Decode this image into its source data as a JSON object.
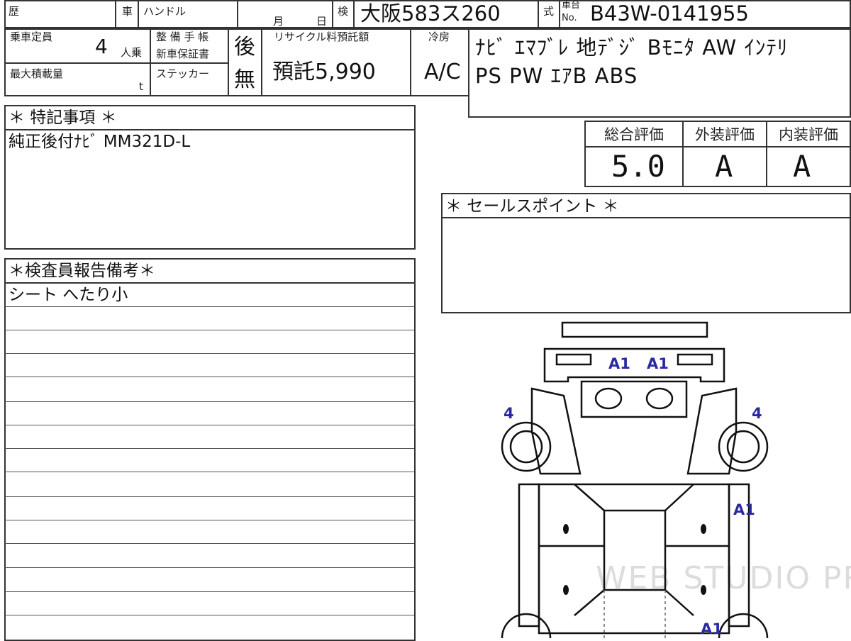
{
  "header": {
    "history_label": "歴",
    "car_label": "車",
    "handle_label": "ハンドル",
    "month_label": "月",
    "day_label": "日",
    "inspection_label": "検",
    "plate": "大阪583ス260",
    "type_label": "式",
    "chassis_label_top": "車台",
    "chassis_label_bottom": "No.",
    "chassis_no": "B43W-0141955"
  },
  "specs": {
    "capacity_label": "乗車定員",
    "capacity_value": "4",
    "capacity_unit": "人乗",
    "maintenance_label_1": "整 備 手 帳",
    "maintenance_label_2": "新車保証書",
    "maintenance_value": "後",
    "max_load_label": "最大積載量",
    "max_load_unit": "t",
    "sticker_label": "ステッカー",
    "sticker_value": "無",
    "recycle_label": "リサイクル料預託額",
    "recycle_value": "預託5,990",
    "cooler_label": "冷房",
    "cooler_value": "A/C"
  },
  "equipment": {
    "line1": "ﾅﾋﾞ ｴﾏﾌﾞﾚ 地ﾃﾞｼﾞ Bﾓﾆﾀ AW ｲﾝﾃﾘ",
    "line2": "PS PW ｴｱB ABS"
  },
  "special_notes": {
    "title": "＊ 特記事項 ＊",
    "text": "純正後付ﾅﾋﾞ MM321D-L"
  },
  "ratings": {
    "overall_label": "総合評価",
    "overall_value": "5.0",
    "exterior_label": "外装評価",
    "exterior_value": "A",
    "interior_label": "内装評価",
    "interior_value": "A"
  },
  "sales_points": {
    "title": "＊ セールスポイント ＊"
  },
  "inspector": {
    "title": "＊検査員報告備考＊",
    "text": "シート へたり小"
  },
  "car_map": {
    "marks": [
      "A1",
      "A1",
      "4",
      "4",
      "A1",
      "A1"
    ],
    "mark_color": "#2a2aa0"
  },
  "watermark": "WEB STUDIO PRO"
}
